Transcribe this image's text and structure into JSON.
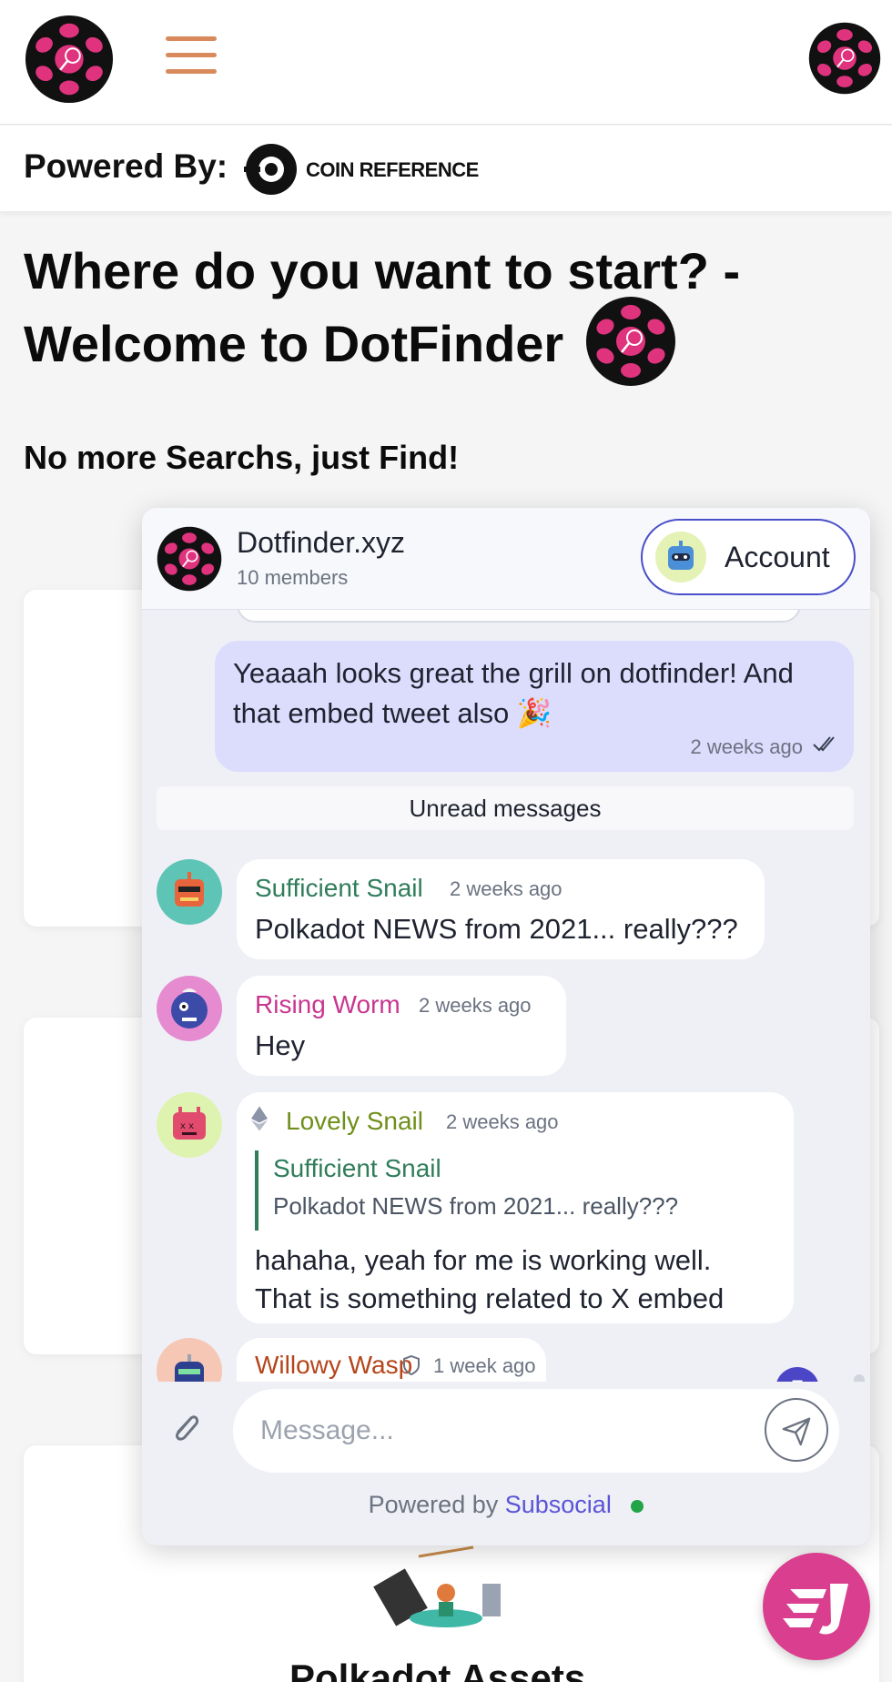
{
  "header": {
    "menu_icon": "hamburger-icon",
    "logo_icon": "dotfinder-logo-icon"
  },
  "powered": {
    "label": "Powered By:",
    "brand": "COIN REFERENCE"
  },
  "hero": {
    "title": "Where do you want to start? - Welcome to DotFinder",
    "subtitle": "No more Searchs, just Find!"
  },
  "background_card": {
    "title": "Polkadot Assets"
  },
  "chat": {
    "title": "Dotfinder.xyz",
    "members": "10 members",
    "account_label": "Account",
    "unread_divider": "Unread messages",
    "messages": [
      {
        "author": "me",
        "text": "Yeaaah looks great the grill on dotfinder! And that embed tweet also 🎉",
        "time": "2 weeks ago",
        "status_icon": "double-check-icon"
      },
      {
        "author": "Sufficient Snail",
        "time": "2 weeks ago",
        "text": "Polkadot NEWS from 2021... really???",
        "name_color": "#2f7d5b",
        "avatar_color": "#5ec4b6"
      },
      {
        "author": "Rising Worm",
        "time": "2 weeks ago",
        "text": "Hey",
        "name_color": "#c8368f",
        "avatar_color": "#e68bd0"
      },
      {
        "author": "Lovely Snail",
        "time": "2 weeks ago",
        "badge_icon": "ethereum-icon",
        "reply_to": {
          "author": "Sufficient Snail",
          "text": "Polkadot NEWS from 2021... really???"
        },
        "text": "hahaha, yeah for me is working well. That is something related to X embed",
        "name_color": "#6f8f1a",
        "avatar_color": "#dff3b0"
      },
      {
        "author": "Willowy Wasp",
        "time": "1 week ago",
        "badge_icon": "shield-icon",
        "name_color": "#b5451b",
        "avatar_color": "#f6c7b4"
      }
    ],
    "unread_count": "7",
    "input_placeholder": "Message...",
    "footer_prefix": "Powered by",
    "footer_brand": "Subsocial"
  },
  "colors": {
    "accent": "#4b46c5",
    "logo_pink": "#e0337e",
    "menu": "#d98a5c",
    "fab": "#d93f8e"
  }
}
